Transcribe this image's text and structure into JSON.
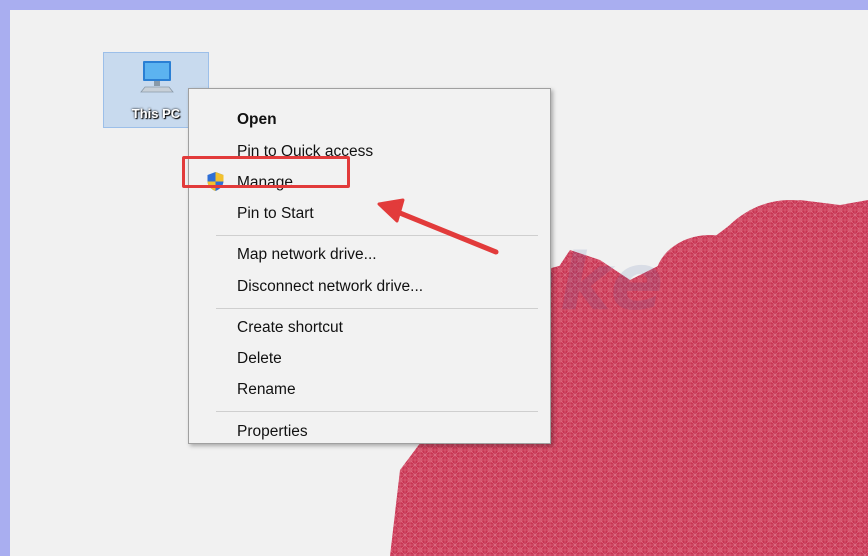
{
  "desktop": {
    "icon_label": "This PC",
    "watermark": "TipsMake"
  },
  "context_menu": {
    "items": [
      {
        "label": "Open",
        "bold": true
      },
      {
        "label": "Pin to Quick access"
      },
      {
        "label": "Manage",
        "icon": "uac-shield-icon",
        "highlighted": true
      },
      {
        "label": "Pin to Start"
      },
      {
        "label": "Map network drive..."
      },
      {
        "label": "Disconnect network drive..."
      },
      {
        "label": "Create shortcut"
      },
      {
        "label": "Delete"
      },
      {
        "label": "Rename"
      },
      {
        "label": "Properties"
      }
    ]
  },
  "colors": {
    "highlight_box": "#e23b3b",
    "annotation_arrow": "#e23b3b",
    "outer_border": "#a9aef0"
  }
}
